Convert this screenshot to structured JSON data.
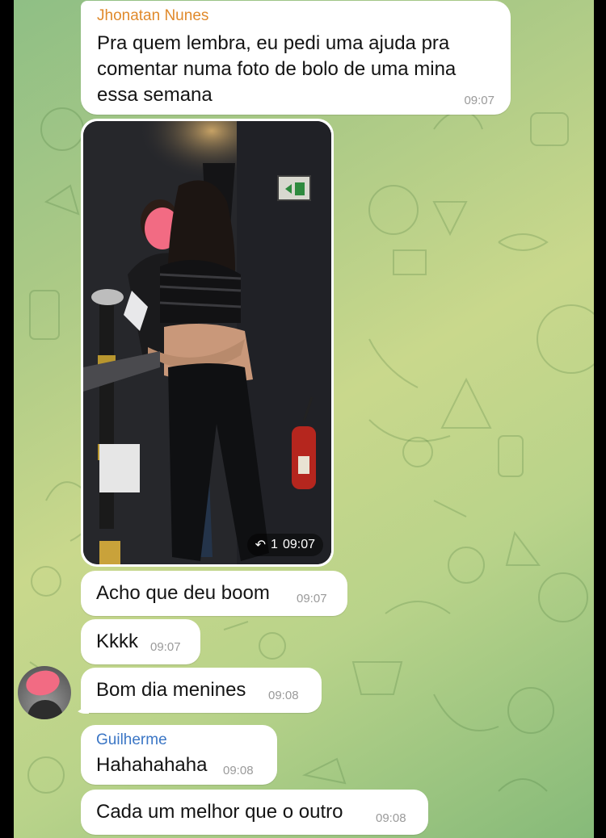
{
  "messages": [
    {
      "sender": "Jhonatan Nunes",
      "text": "Pra quem lembra, eu pedi uma ajuda pra\ncomentar numa foto de bolo de uma mina\nessa semana",
      "time": "09:07"
    },
    {
      "type": "photo",
      "reply_count": "1",
      "time": "09:07",
      "icon": "reply-arrow-icon"
    },
    {
      "text": "Acho que deu boom",
      "time": "09:07"
    },
    {
      "text": "Kkkk",
      "time": "09:07"
    },
    {
      "text": "Bom dia menines",
      "time": "09:08"
    },
    {
      "sender": "Guilherme",
      "text": "Hahahahaha",
      "time": "09:08"
    },
    {
      "text": "Cada um melhor que o outro",
      "time": "09:08"
    }
  ],
  "colors": {
    "jhonatan_name": "#e08a2c",
    "guilherme_name": "#3b76c5",
    "bubble": "#ffffff",
    "time": "#9a9a9a"
  }
}
